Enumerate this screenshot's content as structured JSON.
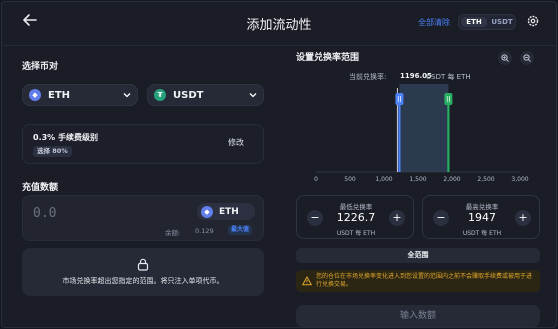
{
  "header": {
    "title": "添加流动性",
    "clear_all": "全部清除",
    "toggle": {
      "eth": "ETH",
      "usdt": "USDT"
    }
  },
  "pair": {
    "section_label": "选择币对",
    "token_a": "ETH",
    "token_b": "USDT"
  },
  "fee": {
    "title": "0.3% 手续费级别",
    "badge": "选择 80%",
    "edit": "修改"
  },
  "deposit": {
    "section_label": "充值数额",
    "amount": "0.0",
    "token": "ETH",
    "balance_label": "余额:",
    "balance_value": "0.129",
    "max": "最大值",
    "locked_note": "市场兑换率超出您指定的范围。将只注入单项代币。"
  },
  "range": {
    "section_label": "设置兑换率范围",
    "current_rate_label": "当前兑换率:",
    "current_rate_value": "1196.05",
    "current_rate_unit": "USDT 每 ETH",
    "min": {
      "label": "最低兑换率",
      "value": "1226.7",
      "unit": "USDT 每 ETH"
    },
    "max": {
      "label": "最高兑换率",
      "value": "1947",
      "unit": "USDT 每 ETH"
    },
    "full_range": "全范围",
    "warning": "您的仓位在市场兑换率变化进入到您设置的范围内之前不会赚取手续费或被用于进行兑换交易。",
    "submit": "输入数额"
  },
  "chart_data": {
    "type": "area",
    "x_ticks": [
      "0",
      "500",
      "1,000",
      "1,500",
      "2,000",
      "2,500",
      "3,000"
    ],
    "xlim": [
      0,
      3000
    ],
    "current_price": 1196.05,
    "selected_range": [
      1226.7,
      1947
    ],
    "colors": {
      "range_fill": "#2b3a4e",
      "left_handle": "#4c82fb",
      "right_handle": "#27ae60",
      "current": "#ffffff"
    }
  },
  "icons": {
    "back": "arrow-left-icon",
    "settings": "gear-icon",
    "zoom_in": "zoom-in-icon",
    "zoom_out": "zoom-out-icon",
    "lock": "lock-icon",
    "warning": "warning-icon"
  },
  "colors": {
    "accent": "#4c82fb",
    "warning": "#e3a82b",
    "background": "#1a1d26"
  }
}
